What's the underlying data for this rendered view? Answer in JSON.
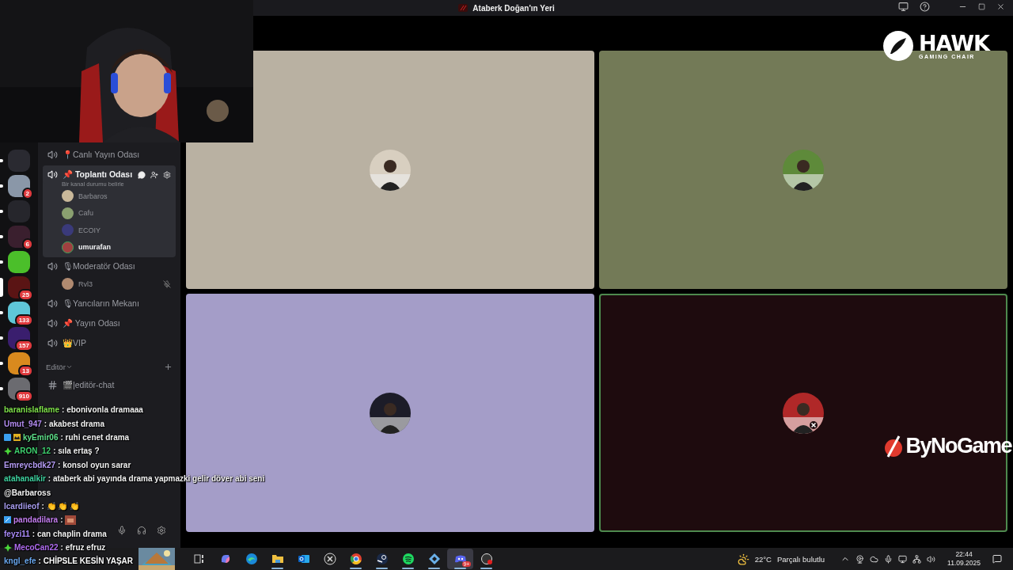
{
  "window": {
    "title": "Ataberk Doğan'ın Yeri"
  },
  "servers": [
    {
      "color": "#2a2a31",
      "selected": false
    },
    {
      "color": "#8a97a8",
      "selected": false,
      "badge": "2"
    },
    {
      "color": "#26262c",
      "selected": false
    },
    {
      "color": "#3a1f2e",
      "selected": false,
      "badge": "6"
    },
    {
      "color": "#4bbf2a",
      "selected": false
    },
    {
      "color": "#5a1414",
      "selected": true,
      "badge": "25"
    },
    {
      "color": "#5fc6d8",
      "selected": false,
      "badge": "133"
    },
    {
      "color": "#3a1e6e",
      "selected": false,
      "badge": "157"
    },
    {
      "color": "#d98a1e",
      "selected": false,
      "badge": "13"
    },
    {
      "color": "#6b6b70",
      "selected": false,
      "badge": "910"
    }
  ],
  "channels": [
    {
      "kind": "voice",
      "name": "📍Canlı Yayın Odası",
      "selected": false
    },
    {
      "kind": "voice",
      "name": "📌 Toplantı Odası",
      "selected": true,
      "status": "Bir kanal durumu belirle",
      "members": [
        {
          "name": "Barbaros",
          "color": "#c9b89a",
          "speaking": false,
          "deafened": false
        },
        {
          "name": "Cafu",
          "color": "#8aa070",
          "speaking": false,
          "deafened": false
        },
        {
          "name": "ECOIY",
          "color": "#3a3a7a",
          "speaking": false,
          "deafened": false
        },
        {
          "name": "umurafan",
          "color": "#a04040",
          "speaking": true,
          "deafened": false
        }
      ]
    },
    {
      "kind": "voice",
      "name": "🎙Moderatör Odası",
      "selected": false,
      "members": [
        {
          "name": "Rvl3",
          "color": "#b08a70",
          "speaking": false,
          "deafened": true
        }
      ]
    },
    {
      "kind": "voice",
      "name": "🎙Yancıların Mekanı",
      "selected": false
    },
    {
      "kind": "voice",
      "name": "📌 Yayın Odası",
      "selected": false
    },
    {
      "kind": "voice",
      "name": "👑VIP",
      "selected": false
    },
    {
      "kind": "category",
      "name": "Editör"
    },
    {
      "kind": "text",
      "name": "🎬|editör-chat",
      "selected": false
    }
  ],
  "tiles": [
    {
      "color": "#b9b1a2",
      "speaking": false,
      "muted": false
    },
    {
      "color": "#737a57",
      "speaking": false,
      "muted": false
    },
    {
      "color": "#a49dc8",
      "speaking": false,
      "muted": false
    },
    {
      "color": "#1e0b0e",
      "speaking": true,
      "muted": true
    }
  ],
  "sponsors": {
    "hawk": {
      "name": "HAWK",
      "tagline": "GAMING CHAIR"
    },
    "bynogame": {
      "name": "ByNoGame"
    }
  },
  "chat": [
    {
      "kind": "plain",
      "user": "baranislaflame",
      "color": "#7ee04a",
      "text": ": ebonivonla dramaaa"
    },
    {
      "kind": "plain",
      "user": "Umut_947",
      "color": "#b38cf0",
      "text": ": akabest drama"
    },
    {
      "kind": "double-badge",
      "user": "kyEmir06",
      "color": "#5ee08a",
      "text": ": ruhi cenet drama"
    },
    {
      "kind": "diamond",
      "user": "ARON_12",
      "color": "#3ecf6e",
      "text": ": sıla ertaş ?"
    },
    {
      "kind": "plain",
      "user": "Emreycbdk27",
      "color": "#b59cf5",
      "text": ": konsol oyun sarar"
    },
    {
      "kind": "plain",
      "user": "atahanalkir",
      "color": "#3fd2a0",
      "text": ": ataberk abi yayında drama yapmazki gelir döver abi seni"
    },
    {
      "kind": "mention",
      "text": "@Barbaross"
    },
    {
      "kind": "plain",
      "user": "Icardiieof",
      "color": "#a89cf0",
      "text": ": 👏 👏 👏"
    },
    {
      "kind": "emote",
      "user": "pandadilara",
      "color": "#c47ef0",
      "text": ":"
    },
    {
      "kind": "plain",
      "user": "feyzi11",
      "color": "#a98af8",
      "text": ": can chaplin drama"
    },
    {
      "kind": "diamond",
      "user": "MecoCan22",
      "color": "#b06cf0",
      "text": ": efruz efruz"
    },
    {
      "kind": "plain",
      "user": "kngl_efe",
      "color": "#6aa8f0",
      "text": ": CHİPSLE KESİN YAŞAR"
    }
  ],
  "taskbar": {
    "apps": [
      {
        "kind": "task-view",
        "open": false,
        "selected": false
      },
      {
        "kind": "petal",
        "open": false,
        "selected": false
      },
      {
        "kind": "wave",
        "open": false,
        "selected": false
      },
      {
        "kind": "folder",
        "open": true,
        "selected": false
      },
      {
        "kind": "mail",
        "open": false,
        "selected": false
      },
      {
        "kind": "arrows",
        "open": false,
        "selected": false
      },
      {
        "kind": "ring",
        "open": true,
        "selected": false
      },
      {
        "kind": "steam",
        "open": true,
        "selected": false
      },
      {
        "kind": "sound",
        "open": true,
        "selected": false
      },
      {
        "kind": "diamond",
        "open": true,
        "selected": false
      },
      {
        "kind": "gamepad",
        "open": true,
        "selected": true,
        "badge": "9+"
      },
      {
        "kind": "record",
        "open": true,
        "selected": false
      }
    ],
    "weather": {
      "temp": "22°C",
      "condition": "Parçalı bulutlu"
    },
    "time": "22:44",
    "date": "11.09.2025"
  }
}
